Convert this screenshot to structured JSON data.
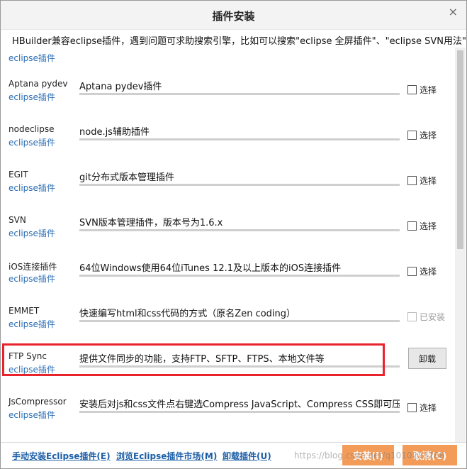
{
  "window": {
    "title": "插件安装",
    "close_label": "×"
  },
  "hint": "HBuilder兼容eclipse插件，遇到问题可求助搜索引擎，比如可以搜索\"eclipse 全屏插件\"、\"eclipse SVN用法\"",
  "partial_row_link": "eclipse插件",
  "plugins": [
    {
      "name": "Aptana pydev",
      "link": "eclipse插件",
      "desc": "Aptana pydev插件",
      "action": "选择"
    },
    {
      "name": "nodeclipse",
      "link": "eclipse插件",
      "desc": "node.js辅助插件",
      "action": "选择"
    },
    {
      "name": "EGIT",
      "link": "eclipse插件",
      "desc": "git分布式版本管理插件",
      "action": "选择"
    },
    {
      "name": "SVN",
      "link": "eclipse插件",
      "desc": "SVN版本管理插件，版本号为1.6.x",
      "action": "选择"
    },
    {
      "name": "iOS连接插件",
      "link": "eclipse插件",
      "desc": "64位Windows使用64位iTunes 12.1及以上版本的iOS连接插件",
      "action": "选择"
    },
    {
      "name": "EMMET",
      "link": "eclipse插件",
      "desc": "快速编写html和css代码的方式（原名Zen coding）",
      "action": "已安装"
    },
    {
      "name": "FTP Sync",
      "link": "eclipse插件",
      "desc": "提供文件同步的功能，支持FTP、SFTP、FTPS、本地文件等",
      "action": "卸载"
    },
    {
      "name": "JsCompressor",
      "link": "eclipse插件",
      "desc": "安装后对js和css文件点右键选Compress JavaScript、Compress CSS即可压缩",
      "action": "选择"
    }
  ],
  "footer": {
    "manual_install": "手动安装Eclipse插件(E)",
    "browse_market": "浏览Eclipse插件市场(M)",
    "uninstall": "卸载插件(U)",
    "install_button": "安装(I)",
    "cancel_button": "取消(C)",
    "watermark": "https://blog.csdn.net/q1010223288"
  },
  "colors": {
    "link": "#2a6db3",
    "highlight": "#e8232b",
    "primary_button": "#f39c5a"
  }
}
